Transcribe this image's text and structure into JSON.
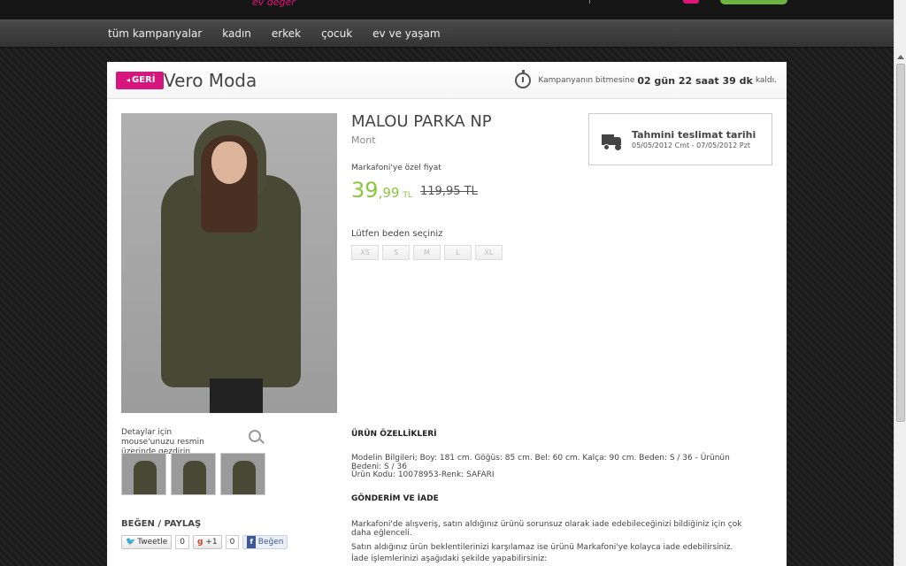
{
  "topbar": {
    "logo_fragment": "ev değer"
  },
  "nav": {
    "items": [
      "tüm kampanyalar",
      "kadın",
      "erkek",
      "çocuk",
      "ev ve yaşam"
    ]
  },
  "header": {
    "back_label": "GERİ",
    "brand": "Vero Moda",
    "timer_prefix": "Kampanyanın bitmesine",
    "timer_value": "02 gün 22 saat 39 dk",
    "timer_suffix": "kaldı."
  },
  "product": {
    "title": "MALOU PARKA NP",
    "category": "Mont",
    "special_price_label": "Markafoni'ye özel fiyat",
    "price_int": "39",
    "price_dec": ",99",
    "currency": "TL",
    "old_price": "119,95 TL",
    "size_label": "Lütfen beden seçiniz",
    "sizes": [
      "XS",
      "S",
      "M",
      "L",
      "XL"
    ]
  },
  "gallery": {
    "hint": "Detaylar için mouse'unuzu resmin üzerinde gezdirin",
    "thumb_count": 3
  },
  "share": {
    "title": "BEĞEN / PAYLAŞ",
    "tweet_label": "Tweetle",
    "tweet_count": "0",
    "gplus_label": "+1",
    "gplus_count": "0",
    "fb_label": "Beğen"
  },
  "delivery": {
    "title": "Tahmini teslimat tarihi",
    "dates": "05/05/2012 Cmt - 07/05/2012 Pzt"
  },
  "details": {
    "features_title": "ÜRÜN ÖZELLİKLERİ",
    "features_line1": "Modelin Bilgileri; Boy: 181 cm. Göğüs: 85 cm. Bel: 60 cm. Kalça: 90 cm. Beden: S / 36 - Ürünün Bedeni: S / 36",
    "features_line2": "Ürün Kodu: 10078953-Renk: SAFARI",
    "shipping_title": "GÖNDERİM VE İADE",
    "shipping_line1": "Markafoni'de alışveriş, satın aldığınız ürünü sorunsuz olarak iade edebileceğinizi bildiğiniz için çok daha eğlenceli.",
    "shipping_line2": "Satın aldığınız ürün beklentilerinizi karşılamaz ise ürünü Markafoni'ye kolayca iade edebilirsiniz.",
    "shipping_line3": "İade işlemlerinizi aşağıdaki şekilde yapabilirsiniz:"
  }
}
